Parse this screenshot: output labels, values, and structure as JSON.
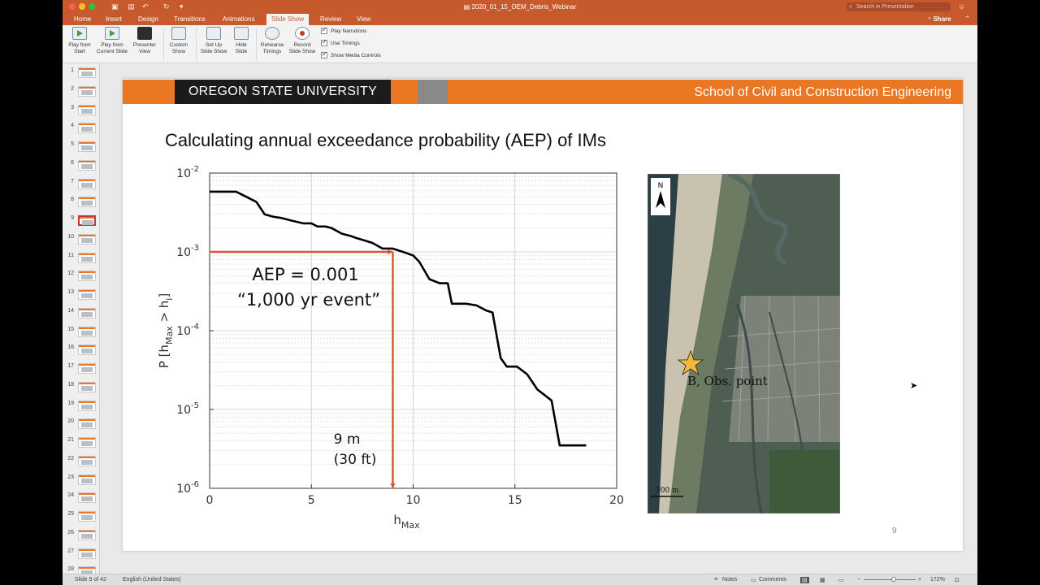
{
  "window": {
    "title": "2020_01_15_OEM_Debris_Webinar",
    "search_placeholder": "Search in Presentation",
    "share_label": "Share"
  },
  "tabs": [
    "Home",
    "Insert",
    "Design",
    "Transitions",
    "Animations",
    "Slide Show",
    "Review",
    "View"
  ],
  "active_tab": "Slide Show",
  "ribbon": {
    "play_from_start": [
      "Play from",
      "Start"
    ],
    "play_from_current": [
      "Play from",
      "Current Slide"
    ],
    "presenter_view": [
      "Presenter",
      "View"
    ],
    "custom_show": [
      "Custom",
      "Show"
    ],
    "set_up": [
      "Set Up",
      "Slide Show"
    ],
    "hide_slide": [
      "Hide",
      "Slide"
    ],
    "rehearse": [
      "Rehearse",
      "Timings"
    ],
    "record": [
      "Record",
      "Slide Show"
    ],
    "play_narrations": "Play Narrations",
    "use_timings": "Use Timings",
    "show_media_controls": "Show Media Controls"
  },
  "thumbnails": {
    "numbers": [
      "1",
      "2",
      "3",
      "4",
      "5",
      "6",
      "7",
      "8",
      "9",
      "10",
      "11",
      "12",
      "13",
      "14",
      "15",
      "16",
      "17",
      "18",
      "19",
      "20",
      "21",
      "22",
      "23",
      "24",
      "25",
      "26",
      "27",
      "28"
    ],
    "selected": 9
  },
  "slide": {
    "university": "OREGON STATE UNIVERSITY",
    "school": "School of Civil and Construction Engineering",
    "title": "Calculating annual exceedance probability (AEP) of IMs",
    "slide_number": "9",
    "annotation_aep": "AEP = 0.001",
    "annotation_event": "“1,000 yr event”",
    "annotation_depth": "9 m",
    "annotation_depth_ft": "(30 ft)",
    "map_obs_label": "B, Obs. point",
    "map_scale": "300 m",
    "map_north": "N"
  },
  "chart_data": {
    "type": "line",
    "xlabel": "h",
    "xlabel_sub": "Max",
    "ylabel": "P [h",
    "ylabel_sub": "Max",
    "ylabel_end": " > h",
    "ylabel_sub2": "i",
    "ylabel_close": "]",
    "xlim": [
      0,
      20
    ],
    "ylim_log10": [
      -6,
      -2
    ],
    "yscale": "log",
    "grid": true,
    "xticks": [
      "0",
      "5",
      "10",
      "15",
      "20"
    ],
    "yticks": [
      {
        "base": "10",
        "exp": "-2",
        "log": -2
      },
      {
        "base": "10",
        "exp": "-3",
        "log": -3
      },
      {
        "base": "10",
        "exp": "-4",
        "log": -4
      },
      {
        "base": "10",
        "exp": "-5",
        "log": -5
      },
      {
        "base": "10",
        "exp": "-6",
        "log": -6
      }
    ],
    "line_color": "#000000",
    "annotation_color": "#d9532c",
    "series": [
      {
        "x": [
          0,
          1.3,
          1.8,
          2.3,
          2.7,
          3.1,
          3.5,
          4.0,
          4.6,
          5.0,
          5.3,
          5.7,
          6.0,
          6.5,
          6.9,
          7.2,
          7.6,
          8.0,
          8.5,
          9.0,
          9.5,
          10.0,
          10.3,
          10.8,
          11.3,
          11.7,
          11.9,
          12.6,
          13.1,
          13.6,
          13.9,
          14.3,
          14.6,
          15.1,
          15.6,
          16.1,
          16.8,
          17.2,
          17.4,
          18.5
        ],
        "y": [
          0.0058,
          0.0058,
          0.005,
          0.0043,
          0.003,
          0.0028,
          0.0027,
          0.0025,
          0.0023,
          0.0023,
          0.0021,
          0.0021,
          0.002,
          0.0017,
          0.0016,
          0.0015,
          0.0014,
          0.0013,
          0.0011,
          0.0011,
          0.001,
          0.0009,
          0.00075,
          0.00045,
          0.0004,
          0.0004,
          0.00022,
          0.00022,
          0.00021,
          0.00018,
          0.00017,
          4.5e-05,
          3.5e-05,
          3.5e-05,
          2.8e-05,
          1.8e-05,
          1.3e-05,
          3.5e-06,
          3.5e-06,
          3.5e-06
        ]
      }
    ],
    "threshold_x": 9,
    "threshold_y": 0.001
  },
  "statusbar": {
    "slide_info": "Slide 9 of 42",
    "language": "English (United States)",
    "notes": "Notes",
    "comments": "Comments",
    "zoom": "172%"
  }
}
